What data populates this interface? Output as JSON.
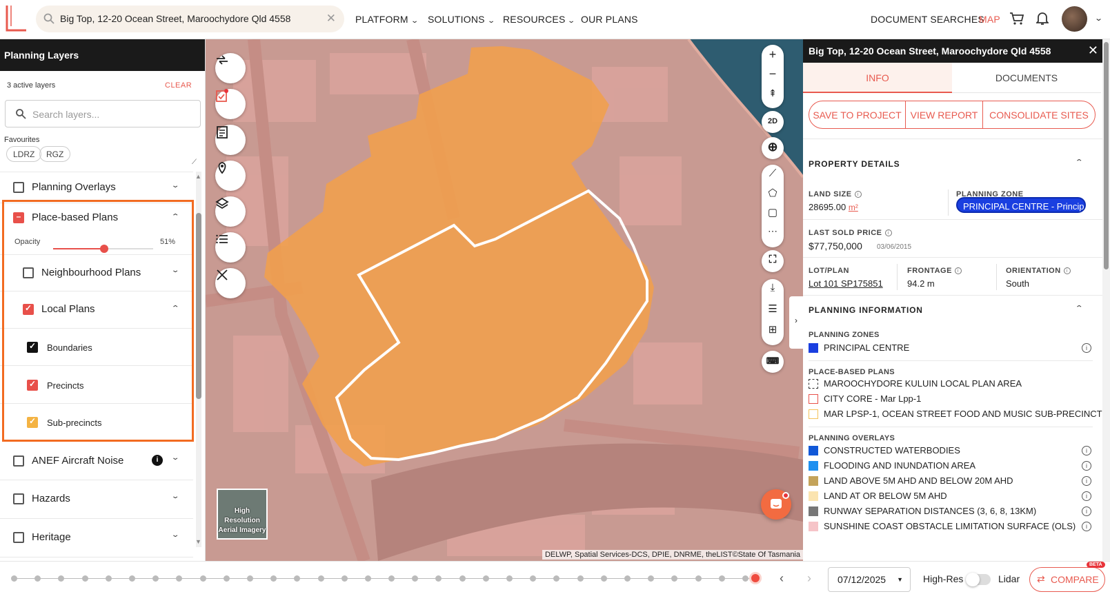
{
  "nav": {
    "search_value": "Big Top, 12-20 Ocean Street, Maroochydore Qld 4558",
    "items": [
      "PLATFORM",
      "SOLUTIONS",
      "RESOURCES",
      "OUR PLANS"
    ],
    "right": {
      "doc_searches": "DOCUMENT SEARCHES",
      "map": "MAP"
    }
  },
  "left": {
    "title": "Planning Layers",
    "active_count": "3 active layers",
    "clear": "CLEAR",
    "search_placeholder": "Search layers...",
    "favourites_label": "Favourites",
    "favourites": [
      "LDRZ",
      "RGZ"
    ],
    "rows": {
      "planning_overlays": "Planning Overlays",
      "place_based": "Place-based Plans",
      "opacity_label": "Opacity",
      "opacity_value": "51%",
      "opacity_fraction": 0.51,
      "neighbourhood": "Neighbourhood Plans",
      "local": "Local Plans",
      "boundaries": "Boundaries",
      "precincts": "Precincts",
      "sub_precincts": "Sub-precincts",
      "anef": "ANEF Aircraft Noise",
      "hazards": "Hazards",
      "heritage": "Heritage"
    }
  },
  "map": {
    "hires_tile": "High Resolution Aerial Imagery",
    "attribution": "DELWP, Spatial Services-DCS, DPIE, DNRME, theLIST©State Of Tasmania",
    "mode_2d": "2D"
  },
  "right": {
    "title": "Big Top, 12-20 Ocean Street, Maroochydore Qld 4558",
    "tabs": [
      "INFO",
      "DOCUMENTS"
    ],
    "actions": [
      "SAVE TO PROJECT",
      "VIEW REPORT",
      "CONSOLIDATE SITES"
    ],
    "property": {
      "section": "PROPERTY DETAILS",
      "land_size_label": "LAND SIZE",
      "land_size_value": "28695.00",
      "land_size_unit": "m²",
      "zone_label": "PLANNING ZONE",
      "zone_value": "PRINCIPAL CENTRE - Principal Centre Zone",
      "last_sold_label": "LAST SOLD PRICE",
      "last_sold_value": "$77,750,000",
      "last_sold_date": "03/06/2015",
      "lot_label": "LOT/PLAN",
      "lot_value": "Lot 101 SP175851",
      "frontage_label": "FRONTAGE",
      "frontage_value": "94.2 m",
      "orientation_label": "ORIENTATION",
      "orientation_value": "South"
    },
    "planning": {
      "section": "PLANNING INFORMATION",
      "zones_label": "PLANNING ZONES",
      "zones": [
        {
          "label": "PRINCIPAL CENTRE",
          "color": "#1a3fe0"
        }
      ],
      "place_label": "PLACE-BASED PLANS",
      "place": [
        {
          "label": "MAROOCHYDORE KULUIN LOCAL PLAN AREA",
          "style": "dashed"
        },
        {
          "label": "CITY CORE - Mar Lpp-1",
          "color": "#e8504a"
        },
        {
          "label": "MAR LPSP-1, OCEAN STREET FOOD AND MUSIC SUB-PRECINCT",
          "color": "#f4c25a"
        }
      ],
      "overlays_label": "PLANNING OVERLAYS",
      "overlays": [
        {
          "label": "CONSTRUCTED WATERBODIES",
          "color": "#1158d8"
        },
        {
          "label": "FLOODING AND INUNDATION AREA",
          "color": "#1e90f0"
        },
        {
          "label": "LAND ABOVE 5M AHD AND BELOW 20M AHD",
          "color": "#c4a35a"
        },
        {
          "label": "LAND AT OR BELOW 5M AHD",
          "color": "#fbe4b0"
        },
        {
          "label": "RUNWAY SEPARATION DISTANCES (3, 6, 8, 13KM)",
          "color": "#777777"
        },
        {
          "label": "SUNSHINE COAST OBSTACLE LIMITATION SURFACE (OLS)",
          "color": "#f6c4c8"
        }
      ]
    }
  },
  "bottom": {
    "date": "07/12/2025",
    "hires": "High-Res",
    "lidar": "Lidar",
    "compare": "COMPARE",
    "beta": "BETA"
  }
}
